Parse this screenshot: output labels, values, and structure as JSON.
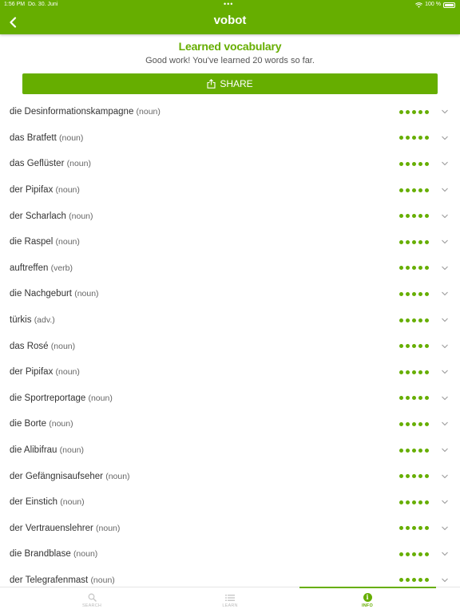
{
  "colors": {
    "brand": "#66ae00"
  },
  "status_bar": {
    "time": "1:56 PM",
    "date": "Do. 30. Juni",
    "center_dots": "•••",
    "battery": "100 %"
  },
  "nav": {
    "title": "vobot",
    "back_icon": "chevron-left-icon"
  },
  "summary": {
    "title": "Learned vocabulary",
    "subtitle": "Good work! You've learned 20 words so far."
  },
  "share": {
    "label": "SHARE",
    "icon": "share-icon"
  },
  "vocab": [
    {
      "term": "die Desinformationskampagne",
      "pos": "(noun)",
      "level": 5
    },
    {
      "term": "das Bratfett",
      "pos": "(noun)",
      "level": 5
    },
    {
      "term": "das Geflüster",
      "pos": "(noun)",
      "level": 5
    },
    {
      "term": "der Pipifax",
      "pos": "(noun)",
      "level": 5
    },
    {
      "term": "der Scharlach",
      "pos": "(noun)",
      "level": 5
    },
    {
      "term": "die Raspel",
      "pos": "(noun)",
      "level": 5
    },
    {
      "term": "auftreffen",
      "pos": "(verb)",
      "level": 5
    },
    {
      "term": "die Nachgeburt",
      "pos": "(noun)",
      "level": 5
    },
    {
      "term": "türkis",
      "pos": "(adv.)",
      "level": 5
    },
    {
      "term": "das Rosé",
      "pos": "(noun)",
      "level": 5
    },
    {
      "term": "der Pipifax",
      "pos": "(noun)",
      "level": 5
    },
    {
      "term": "die Sportreportage",
      "pos": "(noun)",
      "level": 5
    },
    {
      "term": "die Borte",
      "pos": "(noun)",
      "level": 5
    },
    {
      "term": "die Alibifrau",
      "pos": "(noun)",
      "level": 5
    },
    {
      "term": "der Gefängnisaufseher",
      "pos": "(noun)",
      "level": 5
    },
    {
      "term": "der Einstich",
      "pos": "(noun)",
      "level": 5
    },
    {
      "term": "der Vertrauenslehrer",
      "pos": "(noun)",
      "level": 5
    },
    {
      "term": "die Brandblase",
      "pos": "(noun)",
      "level": 5
    },
    {
      "term": "der Telegrafenmast",
      "pos": "(noun)",
      "level": 5
    }
  ],
  "tabs": [
    {
      "label": "SEARCH",
      "icon": "search-icon",
      "active": false
    },
    {
      "label": "LEARN",
      "icon": "list-icon",
      "active": false
    },
    {
      "label": "INFO",
      "icon": "info-icon",
      "active": true,
      "glyph": "i"
    }
  ]
}
